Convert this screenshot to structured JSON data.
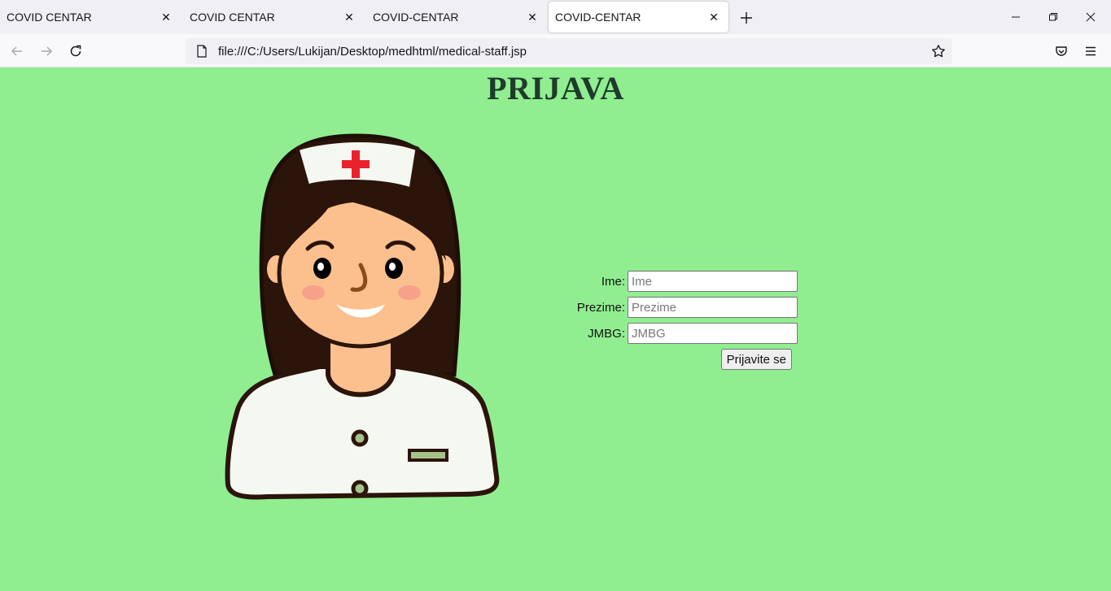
{
  "browser": {
    "tabs": [
      {
        "title": "COVID CENTAR",
        "active": false
      },
      {
        "title": "COVID CENTAR",
        "active": false
      },
      {
        "title": "COVID-CENTAR",
        "active": false
      },
      {
        "title": "COVID-CENTAR",
        "active": true
      }
    ],
    "url": "file:///C:/Users/Lukijan/Desktop/medhtml/medical-staff.jsp"
  },
  "page": {
    "title": "PRIJAVA",
    "background_color": "#90ee90",
    "image_icon": "nurse-illustration",
    "form": {
      "fields": [
        {
          "label": "Ime:",
          "placeholder": "Ime",
          "value": ""
        },
        {
          "label": "Prezime:",
          "placeholder": "Prezime",
          "value": ""
        },
        {
          "label": "JMBG:",
          "placeholder": "JMBG",
          "value": ""
        }
      ],
      "submit_label": "Prijavite se"
    }
  }
}
